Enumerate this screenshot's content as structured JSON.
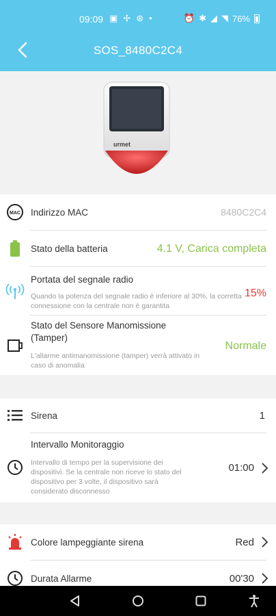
{
  "status_bar": {
    "time": "09:09",
    "battery": "76%"
  },
  "app_bar": {
    "title": "SOS_8480C2C4"
  },
  "info": {
    "mac": {
      "label": "Indirizzo MAC",
      "value": "8480C2C4",
      "icon": "mac-icon"
    },
    "battery": {
      "label": "Stato della batteria",
      "value": "4.1 V, Carica completa",
      "icon": "battery-icon",
      "color": "#8bc34a"
    },
    "signal": {
      "label": "Portata del segnale radio",
      "desc": "Quando la potenza del segnale radio è inferiore al 30%, la corretta connessione con la centrale non è garantita",
      "value": "15%",
      "icon": "signal-icon",
      "color": "#e53935"
    },
    "tamper": {
      "label": "Stato del Sensore Manomissione (Tamper)",
      "desc": "L'allarme antimanomissione (tamper) verrà attivato in caso di anomalia",
      "value": "Normale",
      "icon": "tamper-icon",
      "color": "#8bc34a"
    }
  },
  "settings": {
    "siren": {
      "label": "Sirena",
      "value": "1",
      "icon": "list-icon"
    },
    "interval": {
      "label": "Intervallo Monitoraggio",
      "desc": "Intervallo di tempo per la supervisione dei dispositivi. Se la centrale non riceve lo stato del dispositivo per 3 volte, il dispositivo sarà considerato disconnesso",
      "value": "01:00",
      "icon": "clock-icon"
    }
  },
  "alarm": {
    "color": {
      "label": "Colore lampeggiante sirena",
      "value": "Red",
      "icon": "siren-icon"
    },
    "duration": {
      "label": "Durata Allarme",
      "value": "00'30",
      "icon": "clock-icon"
    }
  },
  "colors": {
    "accent": "#5bc8ec",
    "ok": "#8bc34a",
    "alert": "#e53935"
  }
}
